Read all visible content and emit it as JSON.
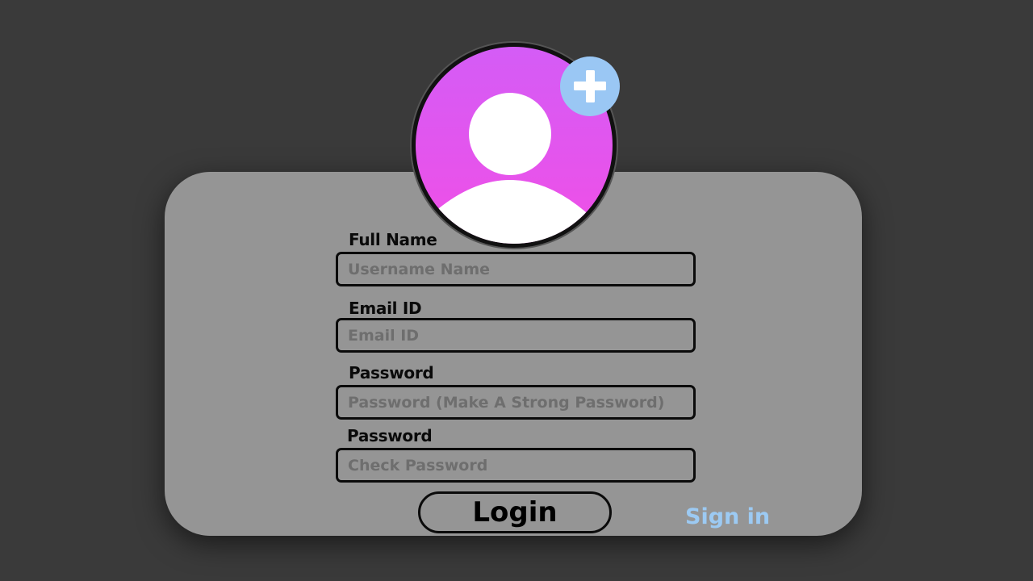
{
  "colors": {
    "background": "#3a3a3a",
    "card": "#959595",
    "avatar_gradient_top": "#d45cf6",
    "avatar_gradient_bottom": "#f04fe6",
    "add_badge": "#9ac7f4",
    "link": "#9ccaf3"
  },
  "avatar": {
    "icon": "user-silhouette-icon",
    "add_icon": "plus-icon"
  },
  "form": {
    "full_name": {
      "label": "Full Name",
      "placeholder": "Username Name"
    },
    "email": {
      "label": "Email ID",
      "placeholder": "Email ID"
    },
    "password": {
      "label": "Password",
      "placeholder": "Password (Make A Strong Password)"
    },
    "confirm_password": {
      "label": "Password",
      "placeholder": "Check Password"
    }
  },
  "actions": {
    "login_label": "Login",
    "signin_label": "Sign in"
  }
}
